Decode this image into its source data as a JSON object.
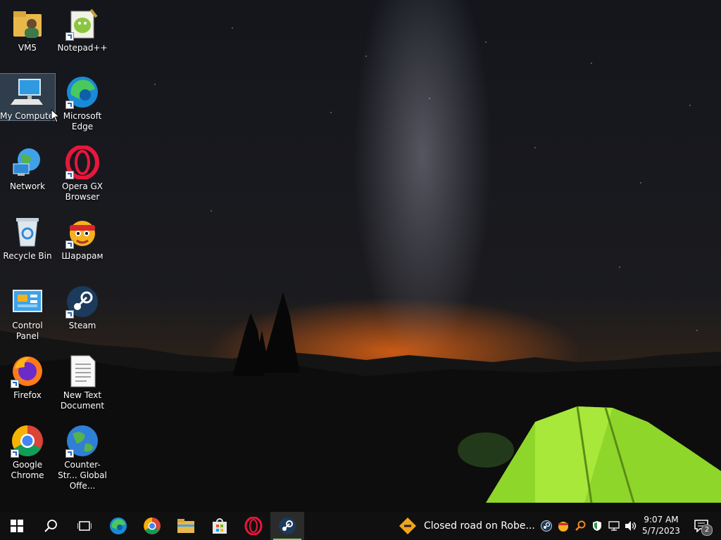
{
  "desktop": {
    "icons": [
      {
        "label": "VM5",
        "icon": "user-folder-icon"
      },
      {
        "label": "Notepad++",
        "icon": "notepadpp-icon"
      },
      {
        "label": "My Computer",
        "icon": "computer-icon"
      },
      {
        "label": "Microsoft Edge",
        "icon": "edge-icon"
      },
      {
        "label": "Network",
        "icon": "network-icon"
      },
      {
        "label": "Opera GX Browser",
        "icon": "opera-gx-icon"
      },
      {
        "label": "Recycle Bin",
        "icon": "recycle-bin-icon"
      },
      {
        "label": "Шарарам",
        "icon": "shararam-icon"
      },
      {
        "label": "Control Panel",
        "icon": "control-panel-icon"
      },
      {
        "label": "Steam",
        "icon": "steam-icon"
      },
      {
        "label": "Firefox",
        "icon": "firefox-icon"
      },
      {
        "label": "New Text Document",
        "icon": "text-document-icon"
      },
      {
        "label": "Google Chrome",
        "icon": "chrome-icon"
      },
      {
        "label": "Counter-Str... Global Offe...",
        "icon": "csgo-icon"
      }
    ]
  },
  "taskbar": {
    "buttons": [
      "start-icon",
      "search-icon",
      "task-view-icon",
      "edge-icon",
      "chrome-icon",
      "file-explorer-icon",
      "microsoft-store-icon",
      "opera-icon",
      "steam-icon"
    ],
    "notification_text": "Closed road on Robe...",
    "clock_time": "9:07 AM",
    "clock_date": "5/7/2023",
    "notification_count": "2"
  },
  "colors": {
    "taskbar": "#101010",
    "active_indicator": "#7fd45a",
    "tent": "#8fd62a"
  }
}
